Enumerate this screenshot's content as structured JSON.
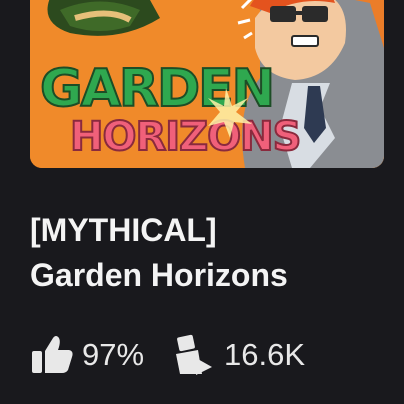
{
  "game_card": {
    "thumbnail": {
      "logo_line1": "GARDEN",
      "logo_line2": "HORIZONS",
      "colors": {
        "background": "#f08a2a",
        "logo_green": "#2fa84f",
        "logo_pink": "#f0607a"
      }
    },
    "title_line1": "[MYTHICAL]",
    "title_line2": "Garden Horizons",
    "stats": {
      "rating_icon": "thumbs-up-icon",
      "rating": "97%",
      "players_icon": "player-count-icon",
      "players": "16.6K"
    }
  },
  "colors": {
    "background": "#19191d",
    "text": "#f4f4f4",
    "stat_text": "#e8e8e8"
  }
}
